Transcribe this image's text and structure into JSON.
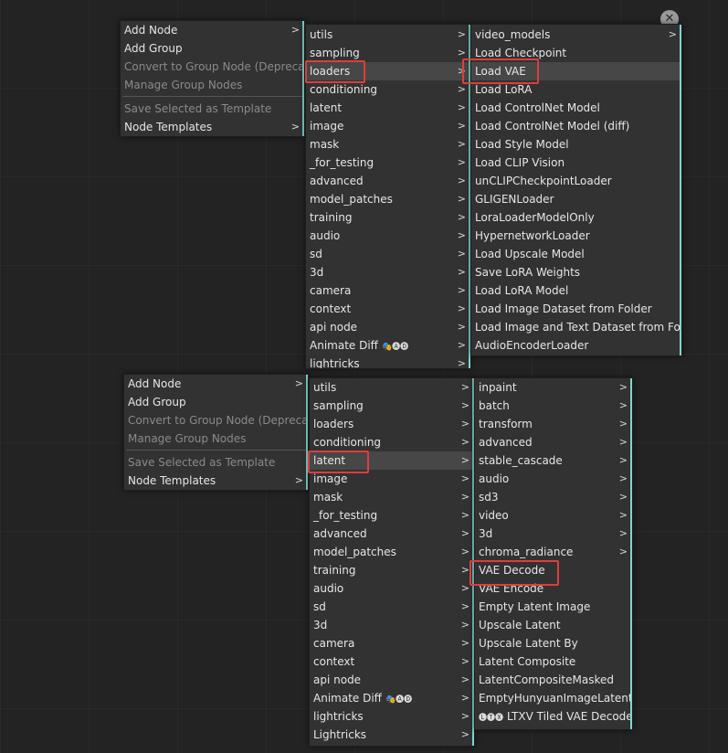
{
  "close_symbol": "✕",
  "arrow": ">",
  "top": {
    "menu": [
      {
        "label": "Add Node",
        "sub": true
      },
      {
        "label": "Add Group"
      },
      {
        "label": "Convert to Group Node (Deprecated)",
        "disabled": true
      },
      {
        "label": "Manage Group Nodes",
        "disabled": true
      },
      {
        "label": "Save Selected as Template",
        "disabled": true,
        "sep": true
      },
      {
        "label": "Node Templates",
        "sub": true
      }
    ],
    "categories": [
      {
        "label": "utils"
      },
      {
        "label": "sampling"
      },
      {
        "label": "loaders",
        "active": true
      },
      {
        "label": "conditioning"
      },
      {
        "label": "latent"
      },
      {
        "label": "image"
      },
      {
        "label": "mask"
      },
      {
        "label": "_for_testing"
      },
      {
        "label": "advanced"
      },
      {
        "label": "model_patches"
      },
      {
        "label": "training"
      },
      {
        "label": "audio"
      },
      {
        "label": "sd"
      },
      {
        "label": "3d"
      },
      {
        "label": "camera"
      },
      {
        "label": "context"
      },
      {
        "label": "api node"
      },
      {
        "label": "Animate Diff",
        "badge": "🎭🅐🅓"
      },
      {
        "label": "lightricks"
      }
    ],
    "items": [
      {
        "label": "video_models",
        "sub": true
      },
      {
        "label": "Load Checkpoint"
      },
      {
        "label": "Load VAE",
        "active": true
      },
      {
        "label": "Load LoRA"
      },
      {
        "label": "Load ControlNet Model"
      },
      {
        "label": "Load ControlNet Model (diff)"
      },
      {
        "label": "Load Style Model"
      },
      {
        "label": "Load CLIP Vision"
      },
      {
        "label": "unCLIPCheckpointLoader"
      },
      {
        "label": "GLIGENLoader"
      },
      {
        "label": "LoraLoaderModelOnly"
      },
      {
        "label": "HypernetworkLoader"
      },
      {
        "label": "Load Upscale Model"
      },
      {
        "label": "Save LoRA Weights"
      },
      {
        "label": "Load LoRA Model"
      },
      {
        "label": "Load Image Dataset from Folder"
      },
      {
        "label": "Load Image and Text Dataset from Folder"
      },
      {
        "label": "AudioEncoderLoader"
      }
    ]
  },
  "bottom": {
    "menu": [
      {
        "label": "Add Node",
        "sub": true
      },
      {
        "label": "Add Group"
      },
      {
        "label": "Convert to Group Node (Deprecated)",
        "disabled": true
      },
      {
        "label": "Manage Group Nodes",
        "disabled": true
      },
      {
        "label": "Save Selected as Template",
        "disabled": true,
        "sep": true
      },
      {
        "label": "Node Templates",
        "sub": true
      }
    ],
    "categories": [
      {
        "label": "utils"
      },
      {
        "label": "sampling"
      },
      {
        "label": "loaders"
      },
      {
        "label": "conditioning"
      },
      {
        "label": "latent",
        "active": true
      },
      {
        "label": "image"
      },
      {
        "label": "mask"
      },
      {
        "label": "_for_testing"
      },
      {
        "label": "advanced"
      },
      {
        "label": "model_patches"
      },
      {
        "label": "training"
      },
      {
        "label": "audio"
      },
      {
        "label": "sd"
      },
      {
        "label": "3d"
      },
      {
        "label": "camera"
      },
      {
        "label": "context"
      },
      {
        "label": "api node"
      },
      {
        "label": "Animate Diff",
        "badge": "🎭🅐🅓"
      },
      {
        "label": "lightricks"
      },
      {
        "label": "Lightricks"
      }
    ],
    "items": [
      {
        "label": "inpaint",
        "sub": true
      },
      {
        "label": "batch",
        "sub": true
      },
      {
        "label": "transform",
        "sub": true
      },
      {
        "label": "advanced",
        "sub": true
      },
      {
        "label": "stable_cascade",
        "sub": true
      },
      {
        "label": "audio",
        "sub": true
      },
      {
        "label": "sd3",
        "sub": true
      },
      {
        "label": "video",
        "sub": true
      },
      {
        "label": "3d",
        "sub": true
      },
      {
        "label": "chroma_radiance",
        "sub": true
      },
      {
        "label": "VAE Decode"
      },
      {
        "label": "VAE Encode"
      },
      {
        "label": "Empty Latent Image"
      },
      {
        "label": "Upscale Latent"
      },
      {
        "label": "Upscale Latent By"
      },
      {
        "label": "Latent Composite"
      },
      {
        "label": "LatentCompositeMasked"
      },
      {
        "label": "EmptyHunyuanImageLatent"
      },
      {
        "label": "LTXV Tiled VAE Decode",
        "ebadge": "🅛🅣🅧"
      }
    ]
  }
}
